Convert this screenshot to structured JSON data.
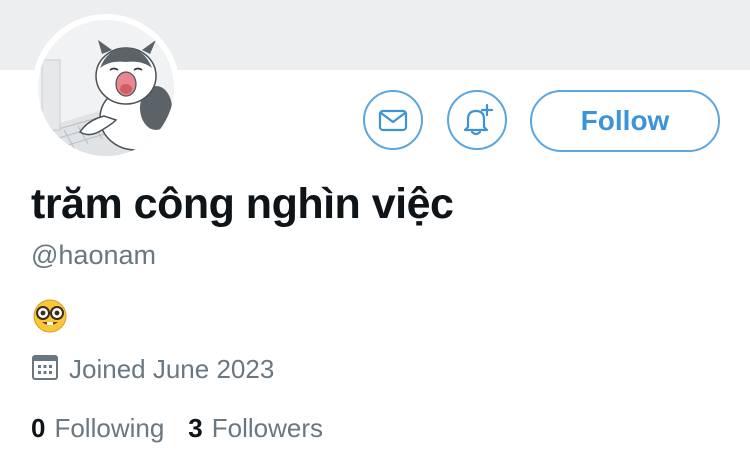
{
  "profile": {
    "display_name": "trăm công nghìn việc",
    "handle": "@haonam",
    "bio_emoji": "nerd-face-emoji",
    "joined": "Joined June 2023",
    "avatar": "cartoon-cat-avatar"
  },
  "actions": {
    "message_icon": "envelope-icon",
    "notify_icon": "bell-plus-icon",
    "follow_label": "Follow"
  },
  "stats": {
    "following_count": "0",
    "following_label": "Following",
    "followers_count": "3",
    "followers_label": "Followers"
  },
  "colors": {
    "accent": "#3b93d8",
    "button_border": "#5aa6e0",
    "secondary_text": "#6a7780",
    "banner": "#eceef0"
  }
}
